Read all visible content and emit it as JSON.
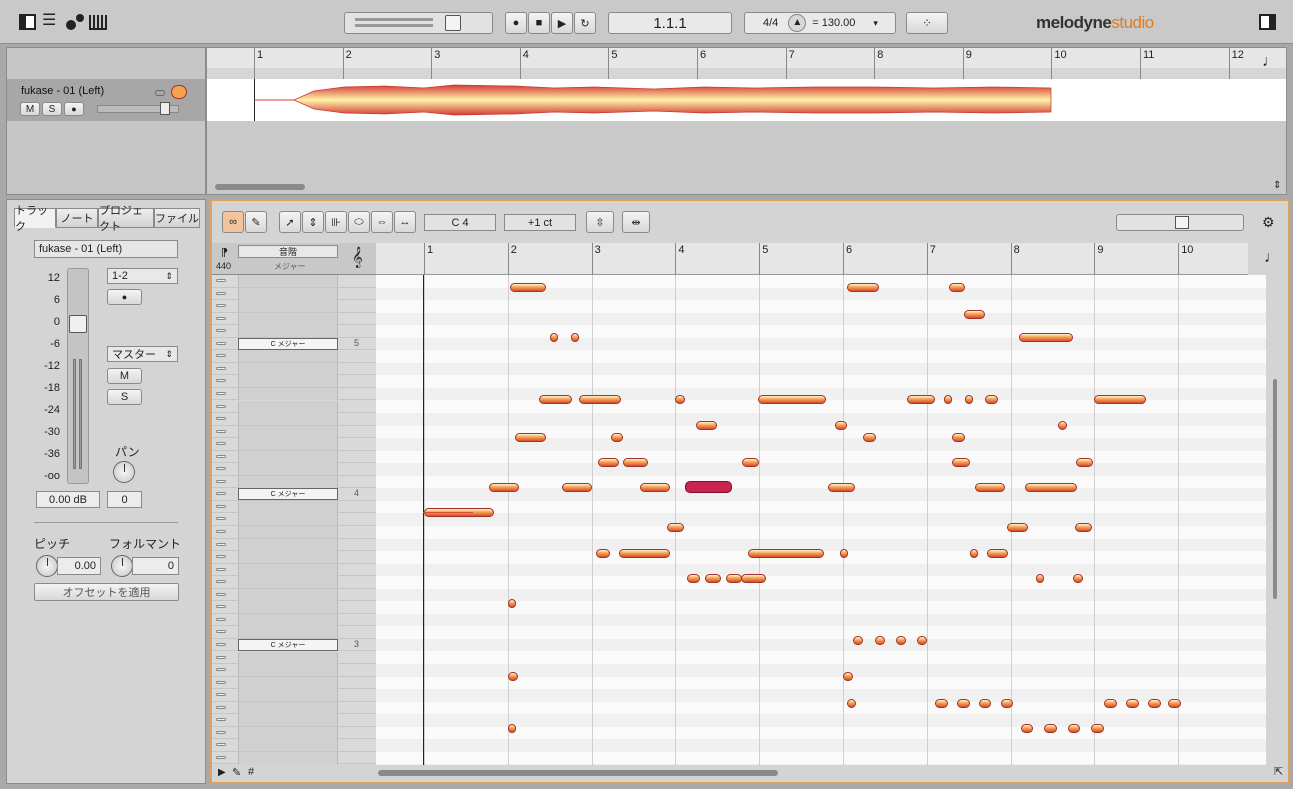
{
  "toolbar": {
    "position": "1.1.1",
    "signature": "4/4",
    "tempo": "= 130.00",
    "logo_brand": "melodyne",
    "logo_edition": "studio"
  },
  "track": {
    "name": "fukase - 01 (Left)",
    "mute": "M",
    "solo": "S"
  },
  "arrange_ruler": [
    "1",
    "2",
    "3",
    "4",
    "5",
    "6",
    "7",
    "8",
    "9",
    "10",
    "11",
    "12"
  ],
  "inspector": {
    "tabs": [
      "トラック",
      "ノート",
      "プロジェクト",
      "ファイル"
    ],
    "track_name": "fukase - 01 (Left)",
    "meter_scale": [
      "12",
      "6",
      "0",
      "-6",
      "-12",
      "-18",
      "-24",
      "-30",
      "-36",
      "-oo"
    ],
    "output": "1-2",
    "master_label": "マスター",
    "m_label": "M",
    "s_label": "S",
    "pan_label": "パン",
    "gain_value": "0.00 dB",
    "pan_value": "0",
    "pitch_label": "ピッチ",
    "formant_label": "フォルマント",
    "pitch_value": "0.00",
    "formant_value": "0",
    "apply_offset": "オフセットを適用"
  },
  "editor": {
    "pitch_field": "C 4",
    "cent_field": "+1 ct",
    "scale_header": "音階",
    "scale_sub": "メジャー",
    "ref_freq": "440",
    "ruler": [
      "1",
      "2",
      "3",
      "4",
      "5",
      "6",
      "7",
      "8",
      "9",
      "10"
    ],
    "octave_labels": [
      {
        "label": "C メジャー",
        "num": "5"
      },
      {
        "label": "C メジャー",
        "num": "4"
      },
      {
        "label": "C メジャー",
        "num": "3"
      }
    ]
  },
  "colors": {
    "accent": "#e07b1e",
    "note_fill": "#f3a24f",
    "note_selected": "#c8244f"
  }
}
